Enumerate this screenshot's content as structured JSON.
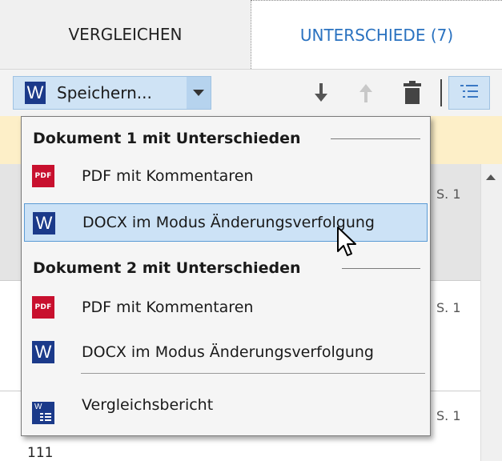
{
  "tabs": [
    {
      "label": "VERGLEICHEN"
    },
    {
      "label": "UNTERSCHIEDE (7)"
    }
  ],
  "toolbar": {
    "save_icon": "word-icon",
    "save_icon_letter": "W",
    "save_label": "Speichern...",
    "icons": [
      "download-icon",
      "upload-icon",
      "trash-icon",
      "list-icon"
    ]
  },
  "menu": {
    "section1_header": "Dokument 1 mit Unterschieden",
    "section1_items": [
      {
        "label": "PDF mit Kommentaren",
        "icon": "pdf-icon",
        "icon_text": "PDF"
      },
      {
        "label": "DOCX im Modus Änderungsverfolgung",
        "icon": "word-icon",
        "icon_text": "W"
      }
    ],
    "section2_header": "Dokument 2 mit Unterschieden",
    "section2_items": [
      {
        "label": "PDF mit Kommentaren",
        "icon": "pdf-icon",
        "icon_text": "PDF"
      },
      {
        "label": "DOCX im Modus Änderungsverfolgung",
        "icon": "word-icon",
        "icon_text": "W"
      }
    ],
    "report_item": {
      "label": "Vergleichsbericht",
      "icon": "report-icon",
      "icon_text": "W"
    }
  },
  "background": {
    "page_refs": [
      "S. 1",
      "S. 1",
      "S. 1"
    ],
    "bottom_number": "111"
  },
  "colors": {
    "accent": "#2a72c0",
    "word_blue": "#1b3a8a",
    "pdf_red": "#c8102e",
    "highlight": "#cce2f6",
    "banner": "#fdefc8"
  }
}
